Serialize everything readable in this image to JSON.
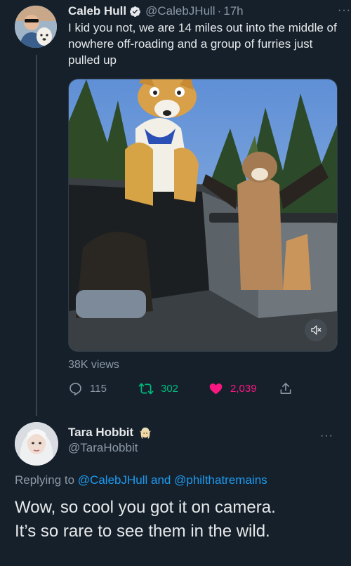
{
  "tweet": {
    "author_name": "Caleb Hull",
    "author_handle": "@CalebJHull",
    "separator": "·",
    "time": "17h",
    "text": "I kid you not, we are 14 miles out into the middle of nowhere off-roading and a group of furries just pulled up",
    "more_label": "···",
    "views": "38K views",
    "reply_count": "115",
    "retweet_count": "302",
    "like_count": "2,039",
    "colors": {
      "retweet": "#00ba7c",
      "like": "#f91880",
      "muted": "#8b98a5",
      "link": "#1d9bf0"
    }
  },
  "reply": {
    "author_name": "Tara Hobbit",
    "author_handle": "@TaraHobbit",
    "more_label": "···",
    "replying_prefix": "Replying to",
    "replying_to_1": "@CalebJHull",
    "replying_and": "and",
    "replying_to_2": "@philthatremains",
    "line1": "Wow, so cool you got it on camera.",
    "line2": "It’s so rare to see them in the wild."
  }
}
